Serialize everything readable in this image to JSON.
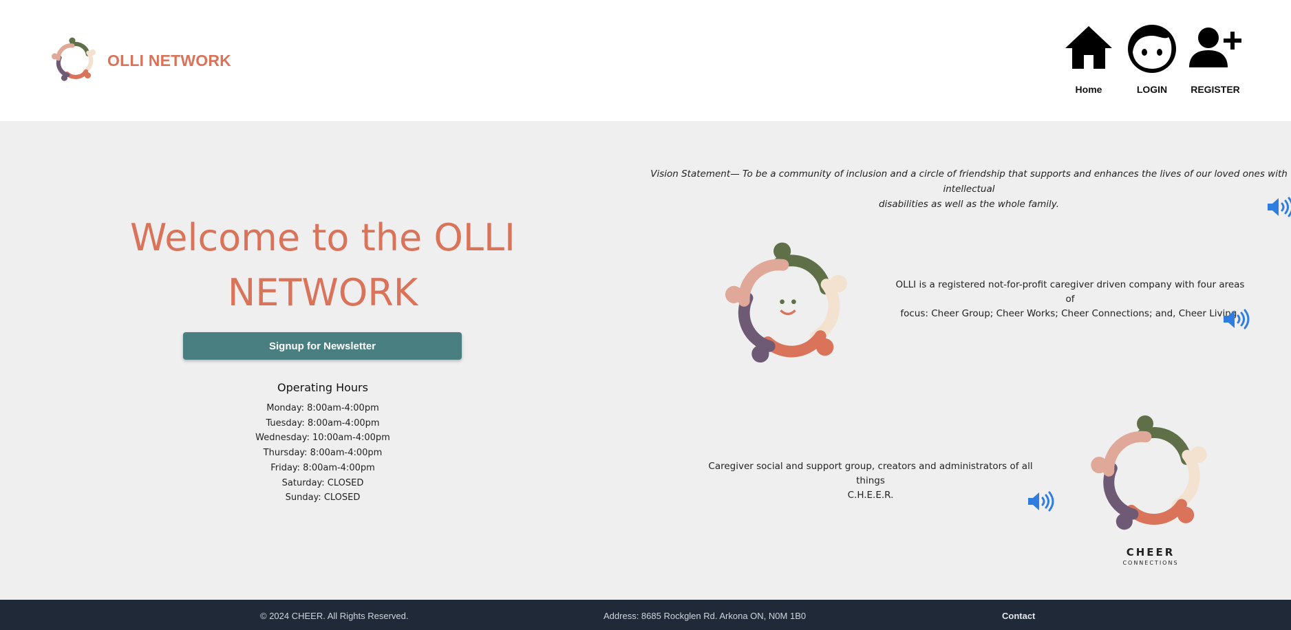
{
  "brand": {
    "name": "OLLI NETWORK",
    "colors": {
      "primary": "#d9735a",
      "button": "#4a7f81",
      "footer": "#1f2937",
      "speaker": "#2f7de1"
    }
  },
  "nav": {
    "items": [
      {
        "label": "Home",
        "icon": "home-icon"
      },
      {
        "label": "LOGIN",
        "icon": "face-icon"
      },
      {
        "label": "REGISTER",
        "icon": "add-user-icon"
      }
    ]
  },
  "hero": {
    "title_line1": "Welcome to the OLLI",
    "title_line2": "NETWORK",
    "newsletter_button": "Signup for Newsletter"
  },
  "hours": {
    "title": "Operating Hours",
    "days": [
      "Monday: 8:00am-4:00pm",
      "Tuesday: 8:00am-4:00pm",
      "Wednesday: 10:00am-4:00pm",
      "Thursday: 8:00am-4:00pm",
      "Friday: 8:00am-4:00pm",
      "Saturday: CLOSED",
      "Sunday: CLOSED"
    ]
  },
  "content": {
    "vision_line1": "Vision Statement— To be a community of inclusion and a circle of friendship that supports and enhances the lives of our loved ones with intellectual",
    "vision_line2": "disabilities as well as the whole family.",
    "olli_line1": "OLLI is a registered not-for-profit caregiver driven company with four areas of",
    "olli_line2": "focus: Cheer Group; Cheer Works; Cheer Connections; and, Cheer Living.",
    "cheer_line1": "Caregiver social and support group, creators and administrators of all things",
    "cheer_line2": "C.H.E.E.R.",
    "cheer_logo_word": "CHEER",
    "cheer_logo_sub": "CONNECTIONS"
  },
  "footer": {
    "copyright": "© 2024 CHEER. All Rights Reserved.",
    "address": "Address: 8685 Rockglen Rd. Arkona ON, N0M 1B0",
    "contact": "Contact"
  }
}
